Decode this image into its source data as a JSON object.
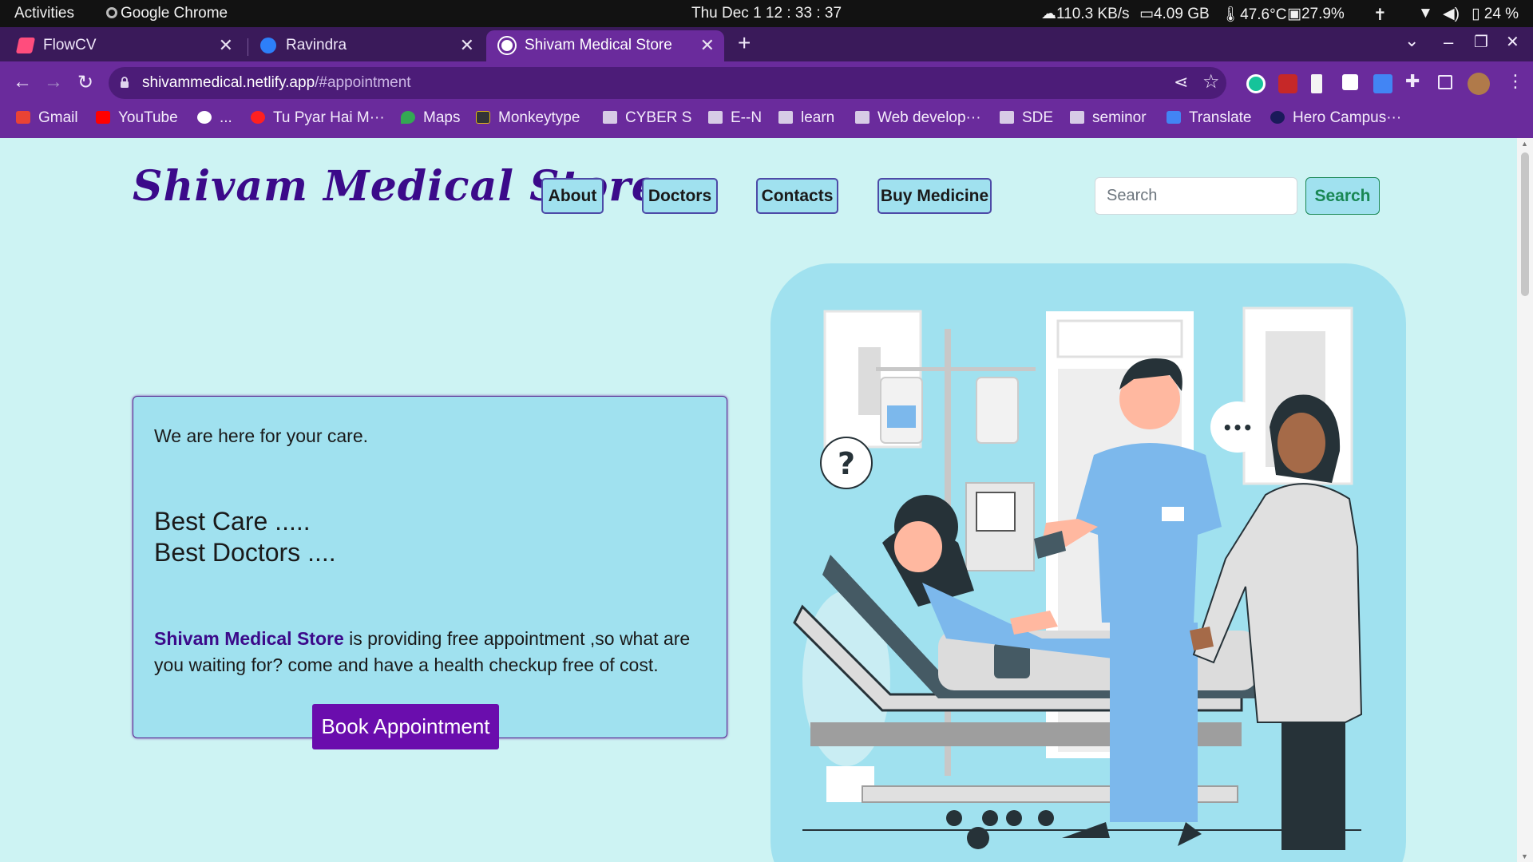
{
  "topbar": {
    "activities": "Activities",
    "app": "Google Chrome",
    "clock": "Thu Dec 1  12 : 33 : 37",
    "net": "110.3 KB/s",
    "mem": "4.09 GB",
    "temp": "47.6°C",
    "disk": "27.9%",
    "battery": "24 %"
  },
  "tabs": [
    {
      "title": "FlowCV",
      "close": "✕"
    },
    {
      "title": "Ravindra",
      "close": "✕"
    },
    {
      "title": "Shivam Medical Store",
      "close": "✕"
    }
  ],
  "new_tab": "+",
  "window": {
    "dropdown": "⌄",
    "minimize": "–",
    "restore": "❐",
    "close": "✕"
  },
  "address": {
    "host": "shivammedical.netlify.app",
    "path": "/#appointment"
  },
  "bookmarks": [
    {
      "label": "Gmail",
      "icon": "gmail-icon",
      "color": "#ea4335"
    },
    {
      "label": "YouTube",
      "icon": "youtube-icon",
      "color": "#ff0000"
    },
    {
      "label": "...",
      "icon": "globe-icon",
      "color": "#ffffff"
    },
    {
      "label": "Tu Pyar Hai M···",
      "icon": "music-icon",
      "color": "#ff2020"
    },
    {
      "label": "Maps",
      "icon": "maps-icon",
      "color": "#34a853"
    },
    {
      "label": "Monkeytype",
      "icon": "monkeytype-icon",
      "color": "#e2b714"
    },
    {
      "label": "CYBER S",
      "icon": "folder-icon",
      "color": "#d7cbe6"
    },
    {
      "label": "E--N",
      "icon": "folder-icon",
      "color": "#d7cbe6"
    },
    {
      "label": "learn",
      "icon": "folder-icon",
      "color": "#d7cbe6"
    },
    {
      "label": "Web develop···",
      "icon": "folder-icon",
      "color": "#d7cbe6"
    },
    {
      "label": "SDE",
      "icon": "folder-icon",
      "color": "#d7cbe6"
    },
    {
      "label": "seminor",
      "icon": "folder-icon",
      "color": "#d7cbe6"
    },
    {
      "label": "Translate",
      "icon": "translate-icon",
      "color": "#4285f4"
    },
    {
      "label": "Hero Campus···",
      "icon": "un-icon",
      "color": "#1a1a5a"
    }
  ],
  "site": {
    "brand": "Shivam Medical Store",
    "nav": [
      "About",
      "Doctors",
      "Contacts",
      "Buy Medicine"
    ],
    "search_placeholder": "Search",
    "search_button": "Search"
  },
  "care": {
    "subtitle": "We are here for your care.",
    "line1": "Best Care .....",
    "line2": "Best Doctors ....",
    "strong": "Shivam Medical Store",
    "paragraph": " is providing free appointment ,so what are you waiting for? come and have a health checkup free of cost.",
    "button": "Book Appointment"
  },
  "illustration": {
    "question": "?",
    "dots": "•••"
  },
  "colors": {
    "brand": "#3b0a8a",
    "page_bg": "#cdf3f3",
    "card_bg": "#a0e1ef",
    "button": "#6a0dad",
    "chrome": "#6a2b9c"
  }
}
